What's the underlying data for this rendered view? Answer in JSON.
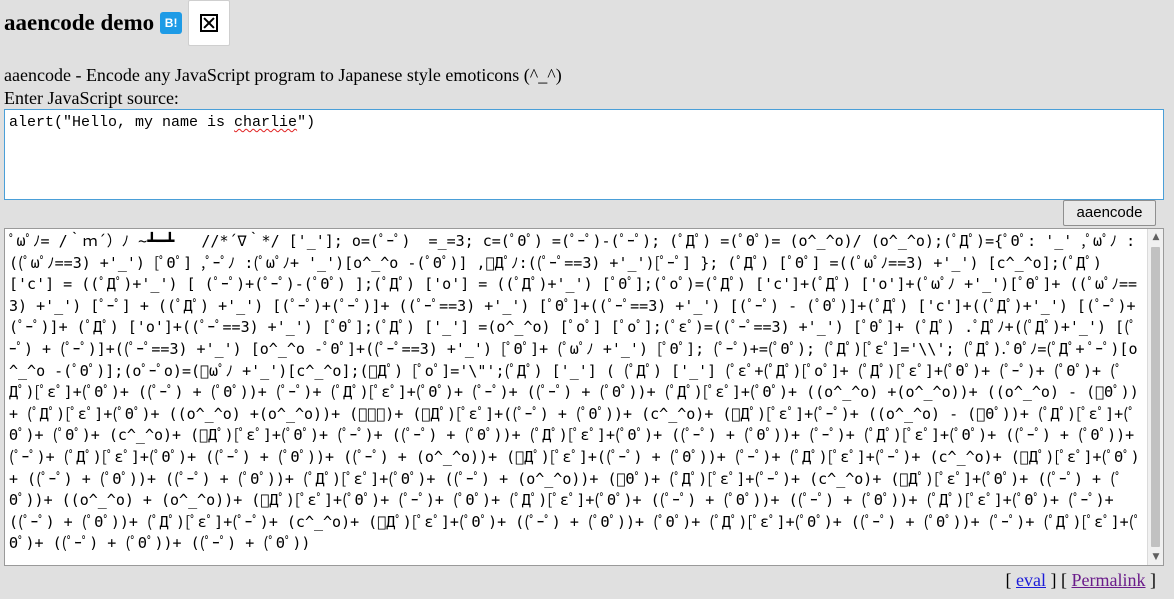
{
  "header": {
    "title": "aaencode demo",
    "hatena_label": "B!"
  },
  "description": "aaencode - Encode any JavaScript program to Japanese style emoticons (^_^)",
  "source_label": "Enter JavaScript source:",
  "source": {
    "prefix": "alert(\"Hello, my name is ",
    "flagged_word": "charlie",
    "suffix": "\")"
  },
  "encode_button": "aaencode",
  "output": "ﾟωﾟﾉ= /｀ｍ´）ﾉ ~┻━┻   //*´∇｀*/ ['_']; o=(ﾟｰﾟ)  =_=3; c=(ﾟΘﾟ) =(ﾟｰﾟ)-(ﾟｰﾟ); (ﾟДﾟ) =(ﾟΘﾟ)= (o^_^o)/ (o^_^o);(ﾟДﾟ)={ﾟΘﾟ: '_' ,ﾟωﾟﾉ : ((ﾟωﾟﾉ==3) +'_') [ﾟΘﾟ] ,ﾟｰﾟﾉ :(ﾟωﾟﾉ+ '_')[o^_^o -(ﾟΘﾟ)] ,ﾟДﾟﾉ:((ﾟｰﾟ==3) +'_')[ﾟｰﾟ] }; (ﾟДﾟ) [ﾟΘﾟ] =((ﾟωﾟﾉ==3) +'_') [c^_^o];(ﾟДﾟ) ['c'] = ((ﾟДﾟ)+'_') [ (ﾟｰﾟ)+(ﾟｰﾟ)-(ﾟΘﾟ) ];(ﾟДﾟ) ['o'] = ((ﾟДﾟ)+'_') [ﾟΘﾟ];(ﾟoﾟ)=(ﾟДﾟ) ['c']+(ﾟДﾟ) ['o']+(ﾟωﾟﾉ +'_')[ﾟΘﾟ]+ ((ﾟωﾟﾉ==3) +'_') [ﾟｰﾟ] + ((ﾟДﾟ) +'_') [(ﾟｰﾟ)+(ﾟｰﾟ)]+ ((ﾟｰﾟ==3) +'_') [ﾟΘﾟ]+((ﾟｰﾟ==3) +'_') [(ﾟｰﾟ) - (ﾟΘﾟ)]+(ﾟДﾟ) ['c']+((ﾟДﾟ)+'_') [(ﾟｰﾟ)+(ﾟｰﾟ)]+ (ﾟДﾟ) ['o']+((ﾟｰﾟ==3) +'_') [ﾟΘﾟ];(ﾟДﾟ) ['_'] =(o^_^o) [ﾟoﾟ] [ﾟoﾟ];(ﾟεﾟ)=((ﾟｰﾟ==3) +'_') [ﾟΘﾟ]+ (ﾟДﾟ) .ﾟДﾟﾉ+((ﾟДﾟ)+'_') [(ﾟｰﾟ) + (ﾟｰﾟ)]+((ﾟｰﾟ==3) +'_') [o^_^o -ﾟΘﾟ]+((ﾟｰﾟ==3) +'_') [ﾟΘﾟ]+ (ﾟωﾟﾉ +'_') [ﾟΘﾟ]; (ﾟｰﾟ)+=(ﾟΘﾟ); (ﾟДﾟ)[ﾟεﾟ]='\\\\'; (ﾟДﾟ).ﾟΘﾟﾉ=(ﾟДﾟ+ ﾟｰﾟ)[o^_^o -(ﾟΘﾟ)];(oﾟｰﾟo)=(ﾟωﾟﾉ +'_')[c^_^o];(ﾟДﾟ) [ﾟoﾟ]='\\\"';(ﾟДﾟ) ['_'] ( (ﾟДﾟ) ['_'] (ﾟεﾟ+(ﾟДﾟ)[ﾟoﾟ]+ (ﾟДﾟ)[ﾟεﾟ]+(ﾟΘﾟ)+ (ﾟｰﾟ)+ (ﾟΘﾟ)+ (ﾟДﾟ)[ﾟεﾟ]+(ﾟΘﾟ)+ ((ﾟｰﾟ) + (ﾟΘﾟ))+ (ﾟｰﾟ)+ (ﾟДﾟ)[ﾟεﾟ]+(ﾟΘﾟ)+ (ﾟｰﾟ)+ ((ﾟｰﾟ) + (ﾟΘﾟ))+ (ﾟДﾟ)[ﾟεﾟ]+(ﾟΘﾟ)+ ((o^_^o) +(o^_^o))+ ((o^_^o) - (ﾟΘﾟ))+ (ﾟДﾟ)[ﾟεﾟ]+(ﾟΘﾟ)+ ((o^_^o) +(o^_^o))+ (ﾟｰﾟ)+ (ﾟДﾟ)[ﾟεﾟ]+((ﾟｰﾟ) + (ﾟΘﾟ))+ (c^_^o)+ (ﾟДﾟ)[ﾟεﾟ]+(ﾟｰﾟ)+ ((o^_^o) - (ﾟΘﾟ))+ (ﾟДﾟ)[ﾟεﾟ]+(ﾟΘﾟ)+ (ﾟΘﾟ)+ (c^_^o)+ (ﾟДﾟ)[ﾟεﾟ]+(ﾟΘﾟ)+ (ﾟｰﾟ)+ ((ﾟｰﾟ) + (ﾟΘﾟ))+ (ﾟДﾟ)[ﾟεﾟ]+(ﾟΘﾟ)+ ((ﾟｰﾟ) + (ﾟΘﾟ))+ (ﾟｰﾟ)+ (ﾟДﾟ)[ﾟεﾟ]+(ﾟΘﾟ)+ ((ﾟｰﾟ) + (ﾟΘﾟ))+ (ﾟｰﾟ)+ (ﾟДﾟ)[ﾟεﾟ]+(ﾟΘﾟ)+ ((ﾟｰﾟ) + (ﾟΘﾟ))+ ((ﾟｰﾟ) + (o^_^o))+ (ﾟДﾟ)[ﾟεﾟ]+((ﾟｰﾟ) + (ﾟΘﾟ))+ (ﾟｰﾟ)+ (ﾟДﾟ)[ﾟεﾟ]+(ﾟｰﾟ)+ (c^_^o)+ (ﾟДﾟ)[ﾟεﾟ]+(ﾟΘﾟ)+ ((ﾟｰﾟ) + (ﾟΘﾟ))+ ((ﾟｰﾟ) + (ﾟΘﾟ))+ (ﾟДﾟ)[ﾟεﾟ]+(ﾟΘﾟ)+ ((ﾟｰﾟ) + (o^_^o))+ (ﾟΘﾟ)+ (ﾟДﾟ)[ﾟεﾟ]+(ﾟｰﾟ)+ (c^_^o)+ (ﾟДﾟ)[ﾟεﾟ]+(ﾟΘﾟ)+ ((ﾟｰﾟ) + (ﾟΘﾟ))+ ((o^_^o) + (o^_^o))+ (ﾟДﾟ)[ﾟεﾟ]+(ﾟΘﾟ)+ (ﾟｰﾟ)+ (ﾟΘﾟ)+ (ﾟДﾟ)[ﾟεﾟ]+(ﾟΘﾟ)+ ((ﾟｰﾟ) + (ﾟΘﾟ))+ ((ﾟｰﾟ) + (ﾟΘﾟ))+ (ﾟДﾟ)[ﾟεﾟ]+(ﾟΘﾟ)+ (ﾟｰﾟ)+ ((ﾟｰﾟ) + (ﾟΘﾟ))+ (ﾟДﾟ)[ﾟεﾟ]+(ﾟｰﾟ)+ (c^_^o)+ (ﾟДﾟ)[ﾟεﾟ]+(ﾟΘﾟ)+ ((ﾟｰﾟ) + (ﾟΘﾟ))+ (ﾟΘﾟ)+ (ﾟДﾟ)[ﾟεﾟ]+(ﾟΘﾟ)+ ((ﾟｰﾟ) + (ﾟΘﾟ))+ (ﾟｰﾟ)+ (ﾟДﾟ)[ﾟεﾟ]+(ﾟΘﾟ)+ ((ﾟｰﾟ) + (ﾟΘﾟ))+ ((ﾟｰﾟ) + (ﾟΘﾟ))",
  "links": {
    "eval": "eval",
    "permalink": "Permalink"
  }
}
